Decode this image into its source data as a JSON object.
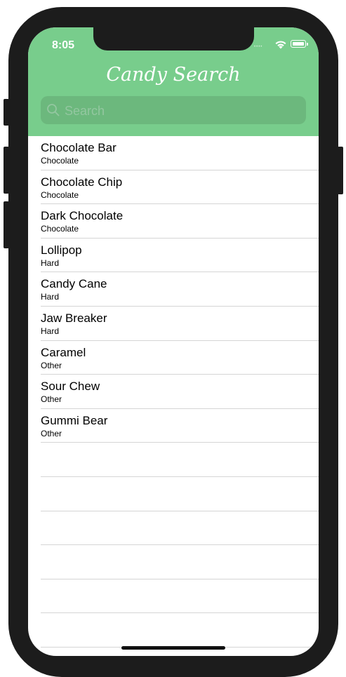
{
  "status_bar": {
    "time": "8:05"
  },
  "nav": {
    "title": "Candy Search",
    "search_placeholder": "Search"
  },
  "candies": [
    {
      "name": "Chocolate Bar",
      "category": "Chocolate"
    },
    {
      "name": "Chocolate Chip",
      "category": "Chocolate"
    },
    {
      "name": "Dark Chocolate",
      "category": "Chocolate"
    },
    {
      "name": "Lollipop",
      "category": "Hard"
    },
    {
      "name": "Candy Cane",
      "category": "Hard"
    },
    {
      "name": "Jaw Breaker",
      "category": "Hard"
    },
    {
      "name": "Caramel",
      "category": "Other"
    },
    {
      "name": "Sour Chew",
      "category": "Other"
    },
    {
      "name": "Gummi Bear",
      "category": "Other"
    }
  ],
  "colors": {
    "nav_background": "#78cd8c",
    "search_background": "#6cb87d",
    "device_frame": "#1c1c1c"
  }
}
